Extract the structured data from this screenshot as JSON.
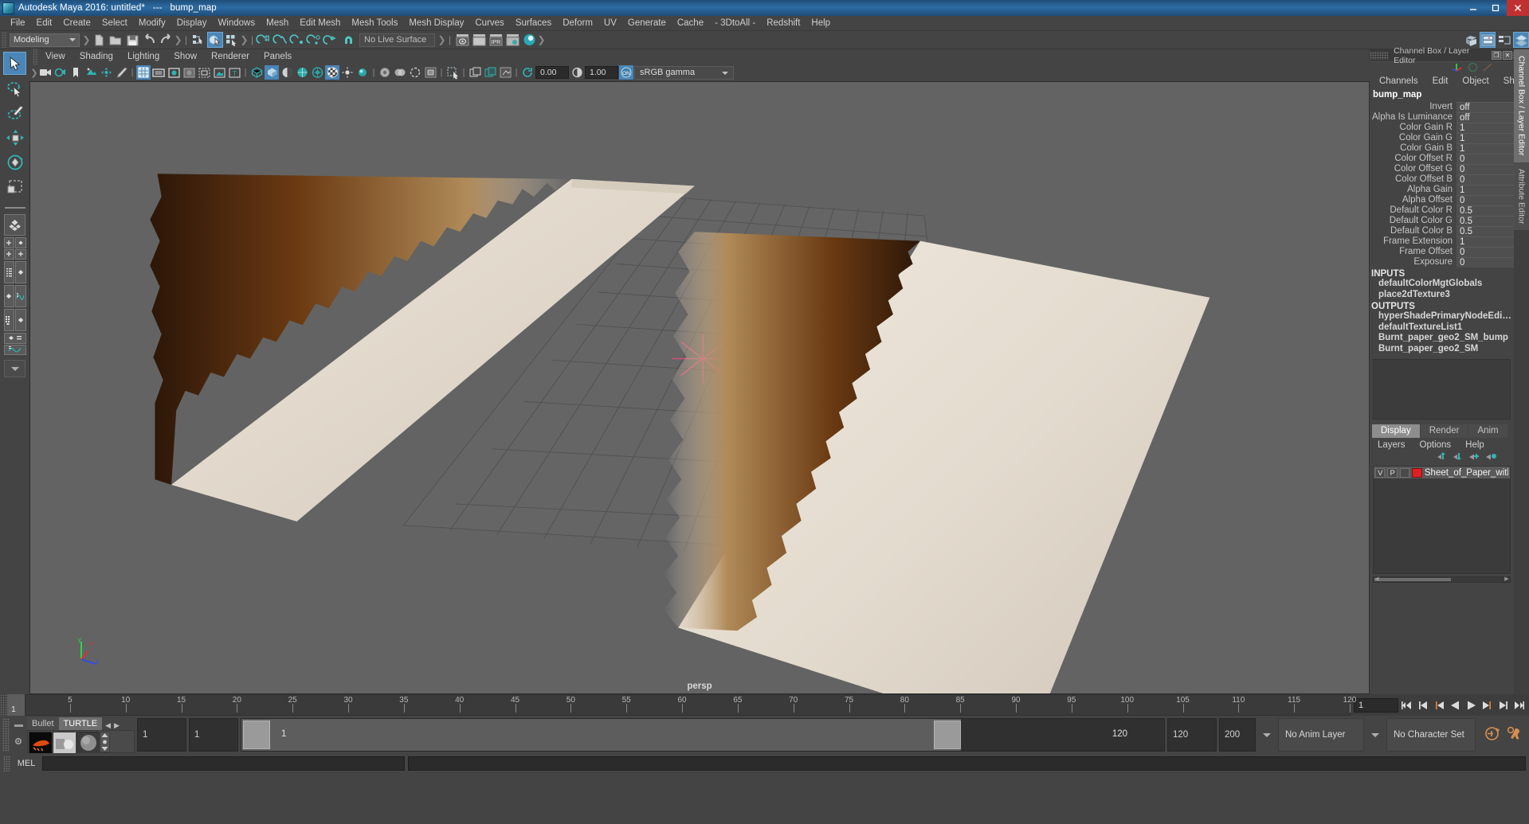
{
  "window": {
    "title": "Autodesk Maya 2016: untitled*   ---   bump_map",
    "minimize_label": "–",
    "maximize_label": "□",
    "close_label": "✕"
  },
  "menubar": {
    "items": [
      "File",
      "Edit",
      "Create",
      "Select",
      "Modify",
      "Display",
      "Windows",
      "Mesh",
      "Edit Mesh",
      "Mesh Tools",
      "Mesh Display",
      "Curves",
      "Surfaces",
      "Deform",
      "UV",
      "Generate",
      "Cache",
      "- 3DtoAll -",
      "Redshift",
      "Help"
    ]
  },
  "toolbar": {
    "menuset": "Modeling",
    "live_surface": "No Live Surface",
    "icons": [
      "new-scene-icon",
      "open-scene-icon",
      "save-scene-icon",
      "undo-icon",
      "redo-icon",
      "select-by-hierarchy-icon",
      "select-by-object-icon",
      "select-by-component-icon",
      "snap-to-grid-icon",
      "snap-to-curve-icon",
      "snap-to-point-icon",
      "snap-to-projected-center-icon",
      "snap-to-view-plane-icon",
      "magnet-icon",
      "render-current-frame-icon",
      "render-sequence-icon",
      "ipr-render-icon",
      "render-settings-icon",
      "hypershade-icon"
    ],
    "right_icons": [
      "show-hide-modeling-toolkit-icon",
      "show-hide-attribute-editor-icon",
      "show-hide-tool-settings-icon",
      "show-hide-channel-box-icon"
    ]
  },
  "toolbox": {
    "items": [
      {
        "name": "select-tool",
        "selected": true
      },
      {
        "name": "lasso-select-tool",
        "selected": false
      },
      {
        "name": "paint-select-tool",
        "selected": false
      },
      {
        "name": "move-tool",
        "selected": false
      },
      {
        "name": "rotate-tool",
        "selected": false
      },
      {
        "name": "scale-tool",
        "selected": false
      }
    ],
    "layout_items": [
      {
        "name": "single-perspective-layout"
      },
      {
        "name": "four-view-layout"
      },
      {
        "name": "outliner-persp-layout"
      },
      {
        "name": "persp-graph-layout"
      },
      {
        "name": "hypershade-persp-layout"
      },
      {
        "name": "persp-graph-outliner-layout"
      },
      {
        "name": "more-layouts-dropdown"
      }
    ]
  },
  "viewport_panel": {
    "menus": [
      "View",
      "Shading",
      "Lighting",
      "Show",
      "Renderer",
      "Panels"
    ],
    "exposure_value": "0.00",
    "gamma_value": "1.00",
    "color_management": "sRGB gamma",
    "camera_label": "persp",
    "axis_labels": {
      "x": "x",
      "y": "y",
      "z": "z"
    },
    "icons": [
      "camera-settings-icon",
      "camera-attributes-icon",
      "bookmark-icon",
      "image-plane-icon",
      "2d-pan-zoom-icon",
      "grease-pencil-icon",
      "grid-toggle-icon",
      "film-gate-icon",
      "resolution-gate-icon",
      "gate-mask-icon",
      "film-origin-icon",
      "exposure-icon",
      "safe-title-icon",
      "wireframe-shading-icon",
      "smooth-shading-icon",
      "smooth-shade-all-icon",
      "shaded-wireframe-icon",
      "textured-icon",
      "use-all-lights-icon",
      "shadows-icon",
      "ambient-occlusion-icon",
      "anti-alias-icon",
      "motion-blur-icon",
      "multisample-icon",
      "isolate-select-icon",
      "xray-icon",
      "xray-joints-icon",
      "xray-active-components-icon",
      "color-management-toggle-icon"
    ]
  },
  "channel_box": {
    "panel_title": "Channel Box / Layer Editor",
    "menus": [
      "Channels",
      "Edit",
      "Object",
      "Show"
    ],
    "object_name": "bump_map",
    "attributes": [
      {
        "label": "Invert",
        "value": "off"
      },
      {
        "label": "Alpha Is Luminance",
        "value": "off"
      },
      {
        "label": "Color Gain R",
        "value": "1"
      },
      {
        "label": "Color Gain G",
        "value": "1"
      },
      {
        "label": "Color Gain B",
        "value": "1"
      },
      {
        "label": "Color Offset R",
        "value": "0"
      },
      {
        "label": "Color Offset G",
        "value": "0"
      },
      {
        "label": "Color Offset B",
        "value": "0"
      },
      {
        "label": "Alpha Gain",
        "value": "1"
      },
      {
        "label": "Alpha Offset",
        "value": "0"
      },
      {
        "label": "Default Color R",
        "value": "0.5"
      },
      {
        "label": "Default Color G",
        "value": "0.5"
      },
      {
        "label": "Default Color B",
        "value": "0.5"
      },
      {
        "label": "Frame Extension",
        "value": "1"
      },
      {
        "label": "Frame Offset",
        "value": "0"
      },
      {
        "label": "Exposure",
        "value": "0"
      }
    ],
    "inputs_header": "INPUTS",
    "inputs": [
      "defaultColorMgtGlobals",
      "place2dTexture3"
    ],
    "outputs_header": "OUTPUTS",
    "outputs": [
      "hyperShadePrimaryNodeEditorSavedT...",
      "defaultTextureList1",
      "Burnt_paper_geo2_SM_bump",
      "Burnt_paper_geo2_SM"
    ]
  },
  "layer_editor": {
    "tabs": [
      {
        "label": "Display",
        "active": true
      },
      {
        "label": "Render",
        "active": false
      },
      {
        "label": "Anim",
        "active": false
      }
    ],
    "menus": [
      "Layers",
      "Options",
      "Help"
    ],
    "toolbar_icons": [
      "move-layer-up-icon",
      "move-layer-down-icon",
      "create-empty-layer-icon",
      "create-layer-from-selected-icon"
    ],
    "layers": [
      {
        "visibility": "V",
        "playback": "P",
        "shading": "",
        "color": "#e02020",
        "name": "Sheet_of_Paper_with_Bu"
      }
    ]
  },
  "vertical_tabs": [
    {
      "label": "Channel Box / Layer Editor",
      "active": true
    },
    {
      "label": "Attribute Editor",
      "active": false
    }
  ],
  "time_slider": {
    "current_frame": "1",
    "start": 1,
    "end": 120,
    "tick_labels": [
      "5",
      "10",
      "15",
      "20",
      "25",
      "30",
      "35",
      "40",
      "45",
      "50",
      "55",
      "60",
      "65",
      "70",
      "75",
      "80",
      "85",
      "90",
      "95",
      "100",
      "105",
      "110",
      "115",
      "120"
    ],
    "frame_field": "1",
    "playback_buttons": [
      "go-to-start-icon",
      "step-back-keyframe-icon",
      "step-back-frame-icon",
      "play-backwards-icon",
      "play-forwards-icon",
      "step-forward-frame-icon",
      "step-forward-keyframe-icon",
      "go-to-end-icon"
    ]
  },
  "range_slider": {
    "anim_start": "1",
    "range_start": "1",
    "bar_start": "1",
    "bar_end": "120",
    "range_end": "120",
    "anim_end": "200",
    "anim_layer": "No Anim Layer",
    "character_set": "No Character Set",
    "right_icons": [
      "auto-key-icon",
      "animation-preferences-icon"
    ]
  },
  "shelf": {
    "tabs": [
      {
        "label": "Bullet",
        "active": false
      },
      {
        "label": "TURTLE",
        "active": true
      }
    ],
    "prev_label": "◀",
    "next_label": "▶",
    "icons": [
      "turtle-render-icon",
      "turtle-bake-icon",
      "turtle-material-icon"
    ]
  },
  "command_line": {
    "label": "MEL",
    "input_value": "",
    "output_value": ""
  },
  "colors": {
    "accent_blue": "#4a86b8",
    "panel_bg": "#444444",
    "viewport_bg": "#636363",
    "layer_color": "#e02020",
    "title_gradient_start": "#1f4e79"
  }
}
